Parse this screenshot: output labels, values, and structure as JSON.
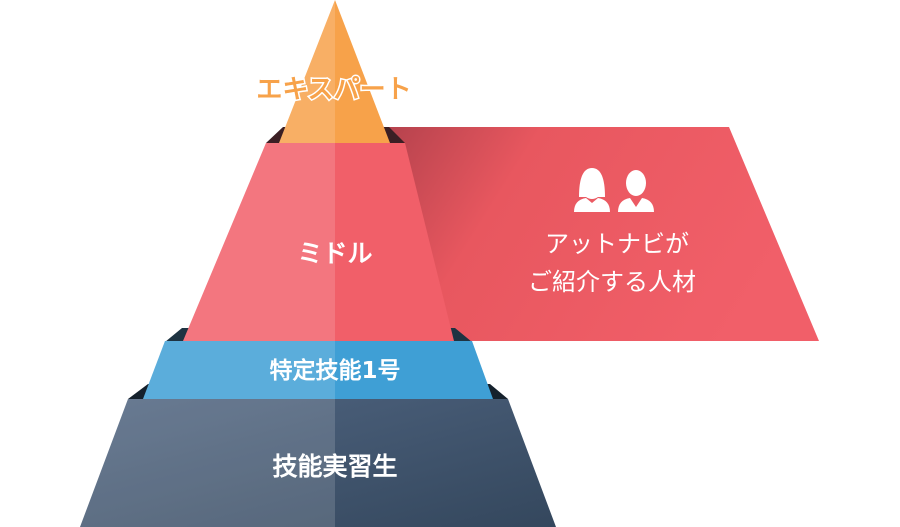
{
  "pyramid": {
    "levels": [
      {
        "label": "エキスパート",
        "color": "#f7a24a"
      },
      {
        "label": "ミドル",
        "color": "#f15f69"
      },
      {
        "label": "特定技能1号",
        "color": "#3f9fd5"
      },
      {
        "label": "技能実習生",
        "color": "#3e536c"
      }
    ]
  },
  "banner": {
    "line1": "アットナビが",
    "line2": "ご紹介する人材",
    "icons": [
      "woman-user-icon",
      "man-user-icon"
    ],
    "color": "#f15f69"
  }
}
